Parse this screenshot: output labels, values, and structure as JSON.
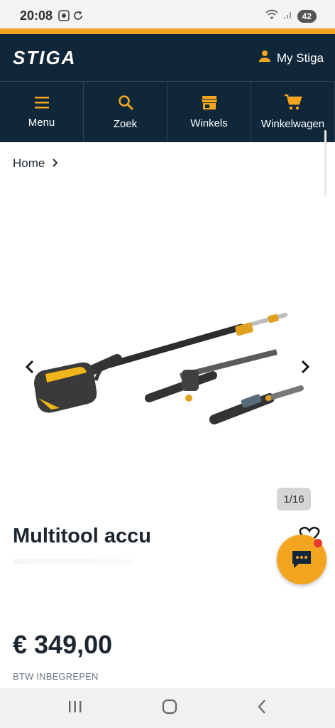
{
  "status_bar": {
    "time": "20:08",
    "battery": "42"
  },
  "header": {
    "brand": "STIGA",
    "account_label": "My Stiga"
  },
  "nav": {
    "items": [
      {
        "label": "Menu",
        "icon": "hamburger-icon"
      },
      {
        "label": "Zoek",
        "icon": "search-icon"
      },
      {
        "label": "Winkels",
        "icon": "store-icon"
      },
      {
        "label": "Winkelwagen",
        "icon": "cart-icon"
      }
    ]
  },
  "breadcrumb": {
    "home": "Home"
  },
  "gallery": {
    "counter": "1/16"
  },
  "product": {
    "title": "Multitool accu",
    "price": "€ 349,00",
    "vat_note": "BTW INBEGREPEN"
  },
  "colors": {
    "navy": "#10273a",
    "accent": "#f3a51f",
    "badge": "#e63b2e"
  }
}
